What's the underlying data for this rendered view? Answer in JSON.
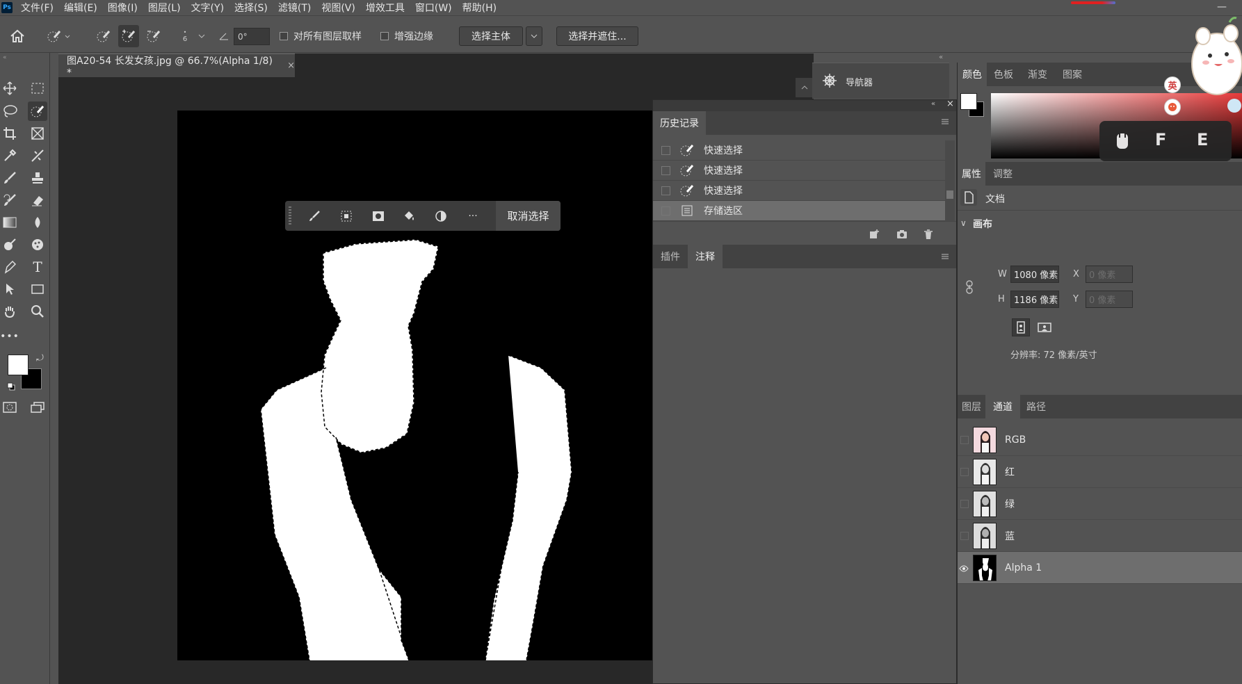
{
  "app": {
    "logo": "Ps"
  },
  "menu": [
    "文件(F)",
    "编辑(E)",
    "图像(I)",
    "图层(L)",
    "文字(Y)",
    "选择(S)",
    "滤镜(T)",
    "视图(V)",
    "增效工具",
    "窗口(W)",
    "帮助(H)"
  ],
  "window": {
    "minimize": "—"
  },
  "options": {
    "brush_size": "6",
    "angle_value": "0°",
    "sample_all_layers": "对所有图层取样",
    "enhance_edge": "增强边缘",
    "select_subject": "选择主体",
    "select_and_mask": "选择并遮住..."
  },
  "document": {
    "tab_title": "图A20-54 长发女孩.jpg @ 66.7%(Alpha 1/8) *",
    "close": "×"
  },
  "context_bar": {
    "deselect": "取消选择",
    "more": "···"
  },
  "navigator": {
    "title": "导航器"
  },
  "history": {
    "tab": "历史记录",
    "items": [
      {
        "label": "快速选择",
        "icon": "quick-select-icon"
      },
      {
        "label": "快速选择",
        "icon": "quick-select-icon"
      },
      {
        "label": "快速选择",
        "icon": "quick-select-icon"
      },
      {
        "label": "存储选区",
        "icon": "save-selection-icon"
      }
    ]
  },
  "notes": {
    "tabs": [
      "插件",
      "注释"
    ]
  },
  "color_panel": {
    "tabs": [
      "颜色",
      "色板",
      "渐变",
      "图案"
    ],
    "foreground": "#ffffff",
    "background": "#000000"
  },
  "ime": {
    "key1": "F",
    "key2": "E",
    "badge": "英"
  },
  "properties": {
    "tabs": [
      "属性",
      "调整"
    ],
    "type": "文档",
    "section": "画布",
    "w_label": "W",
    "w_value": "1080 像素",
    "h_label": "H",
    "h_value": "1186 像素",
    "x_label": "X",
    "x_placeholder": "0 像素",
    "y_label": "Y",
    "y_placeholder": "0 像素",
    "resolution": "分辨率: 72 像素/英寸"
  },
  "layers_panel": {
    "tabs": [
      "图层",
      "通道",
      "路径"
    ],
    "channels": [
      "RGB",
      "红",
      "绿",
      "蓝",
      "Alpha 1"
    ]
  }
}
